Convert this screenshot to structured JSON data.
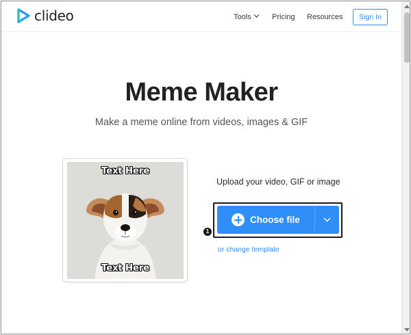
{
  "header": {
    "logo_text": "clideo",
    "nav": {
      "tools_label": "Tools",
      "pricing_label": "Pricing",
      "resources_label": "Resources"
    },
    "signin_label": "Sign In"
  },
  "hero": {
    "title": "Meme Maker",
    "subtitle": "Make a meme online from videos, images & GIF"
  },
  "meme_preview": {
    "top_text": "Text Here",
    "bottom_text": "Text Here"
  },
  "upload": {
    "label": "Upload your video, GIF or image",
    "choose_file_label": "Choose file",
    "change_template_label": "or change template",
    "step_number": "1"
  },
  "icons": {
    "logo": "play-triangle-logo-icon",
    "tools_chevron": "chevron-down-icon",
    "choose_plus": "plus-circle-icon",
    "choose_dropdown": "chevron-down-icon"
  },
  "colors": {
    "accent": "#2f8ef7",
    "logo_teal": "#25c1b5",
    "logo_blue": "#2f8ef7",
    "title": "#222222"
  }
}
